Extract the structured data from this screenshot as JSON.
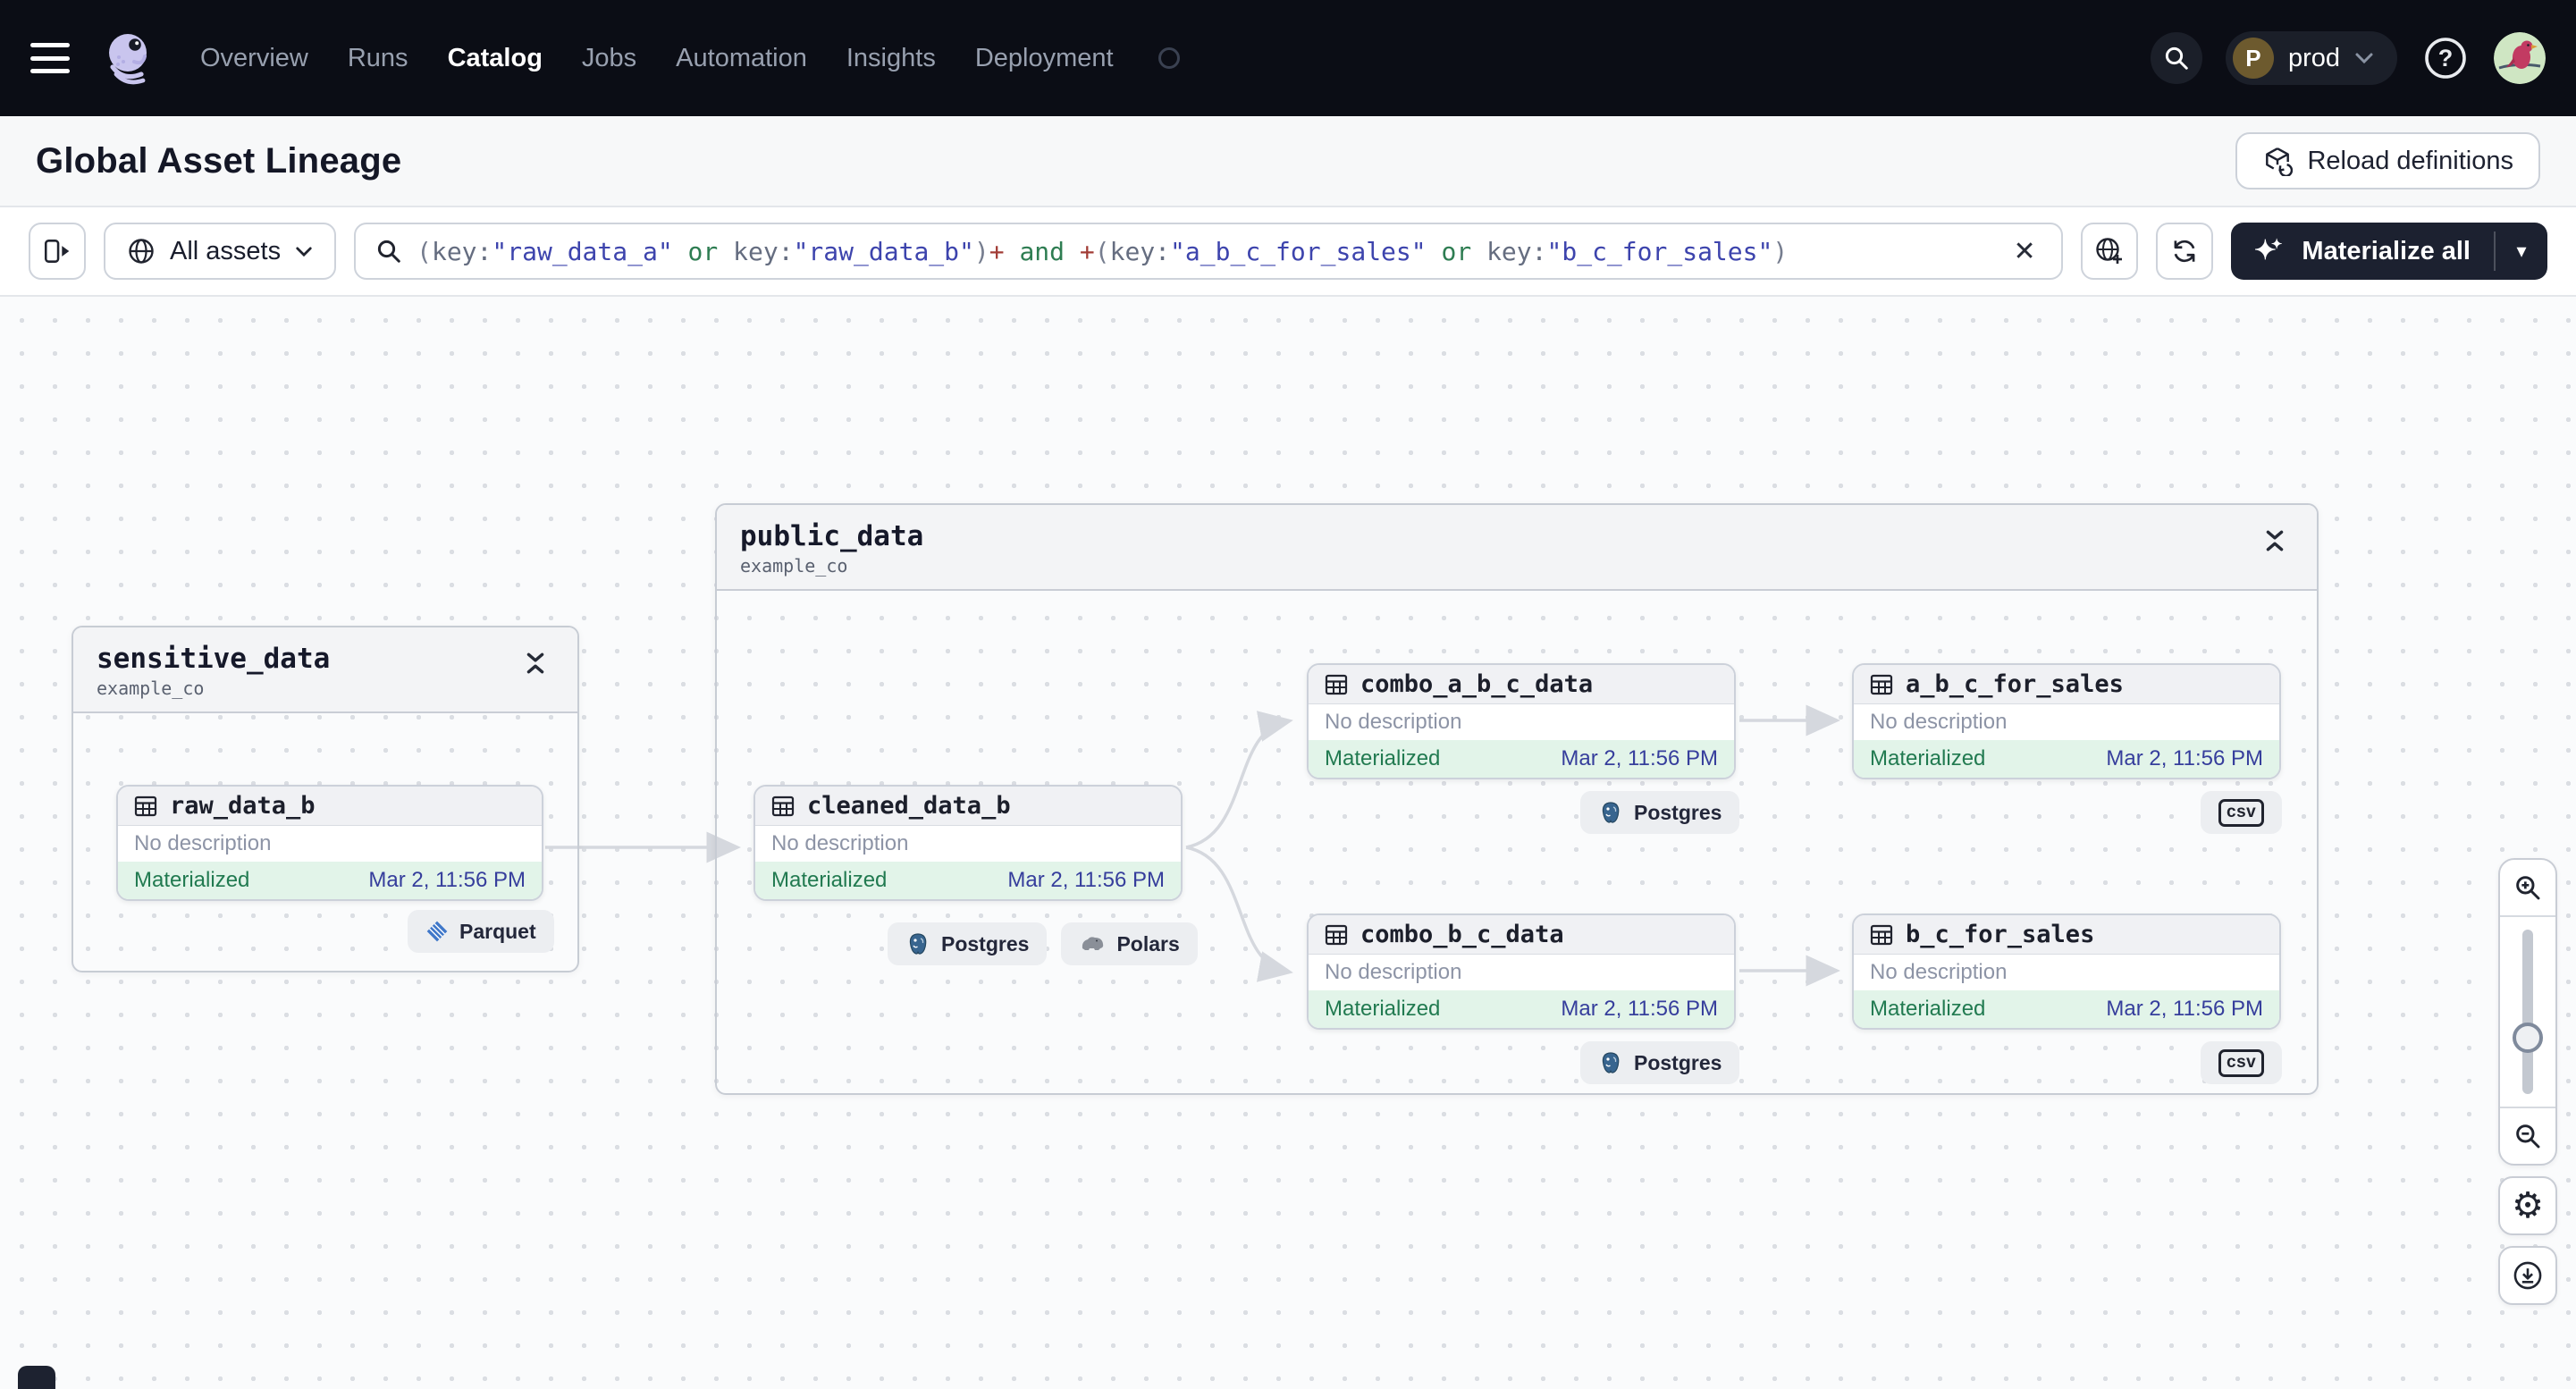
{
  "nav": {
    "items": [
      {
        "label": "Overview"
      },
      {
        "label": "Runs"
      },
      {
        "label": "Catalog"
      },
      {
        "label": "Jobs"
      },
      {
        "label": "Automation"
      },
      {
        "label": "Insights"
      },
      {
        "label": "Deployment"
      }
    ],
    "active_item": "Catalog",
    "workspace": {
      "initial": "P",
      "name": "prod"
    }
  },
  "header": {
    "title": "Global Asset Lineage",
    "reload_button": "Reload definitions"
  },
  "filter": {
    "scope_label": "All assets",
    "materialize_label": "Materialize all",
    "clear_glyph": "✕",
    "query": {
      "full_text": "(key:\"raw_data_a\" or key:\"raw_data_b\")+ and +(key:\"a_b_c_for_sales\" or key:\"b_c_for_sales\")",
      "segments": [
        {
          "text": "("
        },
        {
          "text": "key:"
        },
        {
          "text": "\"raw_data_a\""
        },
        {
          "text": " or "
        },
        {
          "text": "key:"
        },
        {
          "text": "\"raw_data_b\""
        },
        {
          "text": ")"
        },
        {
          "text": "+"
        },
        {
          "text": " and "
        },
        {
          "text": "+"
        },
        {
          "text": "("
        },
        {
          "text": "key:"
        },
        {
          "text": "\"a_b_c_for_sales\""
        },
        {
          "text": " or "
        },
        {
          "text": "key:"
        },
        {
          "text": "\"b_c_for_sales\""
        },
        {
          "text": ")"
        }
      ]
    }
  },
  "graph": {
    "groups": [
      {
        "name": "sensitive_data",
        "location": "example_co"
      },
      {
        "name": "public_data",
        "location": "example_co"
      }
    ],
    "nodes": [
      {
        "name": "raw_data_b",
        "description": "No description",
        "status": "Materialized",
        "timestamp": "Mar 2, 11:56 PM"
      },
      {
        "name": "cleaned_data_b",
        "description": "No description",
        "status": "Materialized",
        "timestamp": "Mar 2, 11:56 PM"
      },
      {
        "name": "combo_a_b_c_data",
        "description": "No description",
        "status": "Materialized",
        "timestamp": "Mar 2, 11:56 PM"
      },
      {
        "name": "a_b_c_for_sales",
        "description": "No description",
        "status": "Materialized",
        "timestamp": "Mar 2, 11:56 PM"
      },
      {
        "name": "combo_b_c_data",
        "description": "No description",
        "status": "Materialized",
        "timestamp": "Mar 2, 11:56 PM"
      },
      {
        "name": "b_c_for_sales",
        "description": "No description",
        "status": "Materialized",
        "timestamp": "Mar 2, 11:56 PM"
      }
    ],
    "badges": {
      "parquet": "Parquet",
      "postgres": "Postgres",
      "polars": "Polars",
      "csv": "csv"
    }
  },
  "icons": {
    "gear": "⚙",
    "sparkles": "✦",
    "caret_down": "▾",
    "descriptions": {
      "hamburger-icon": "three horizontal bars",
      "dagster-logo": "lavender octopus",
      "search-icon": "magnifier",
      "help-icon": "question mark in circle",
      "panel-toggle-icon": "panel with right arrow",
      "globe-icon": "globe",
      "globe-plus-icon": "globe with plus",
      "refresh-icon": "circular arrows",
      "table-icon": "data table grid",
      "collapse-icon": "two chevrons pointing inward",
      "zoom-in-icon": "magnifier with plus",
      "zoom-out-icon": "magnifier with minus",
      "download-icon": "down arrow in circle"
    }
  },
  "colors": {
    "nav_bg": "#0b0d15",
    "status_green_bg": "#e2f4e9",
    "status_green_text": "#217a50",
    "timestamp_indigo": "#363e9c",
    "query_string": "#3d44ad",
    "query_operator": "#2e7d52",
    "query_plus": "#a23c36"
  }
}
